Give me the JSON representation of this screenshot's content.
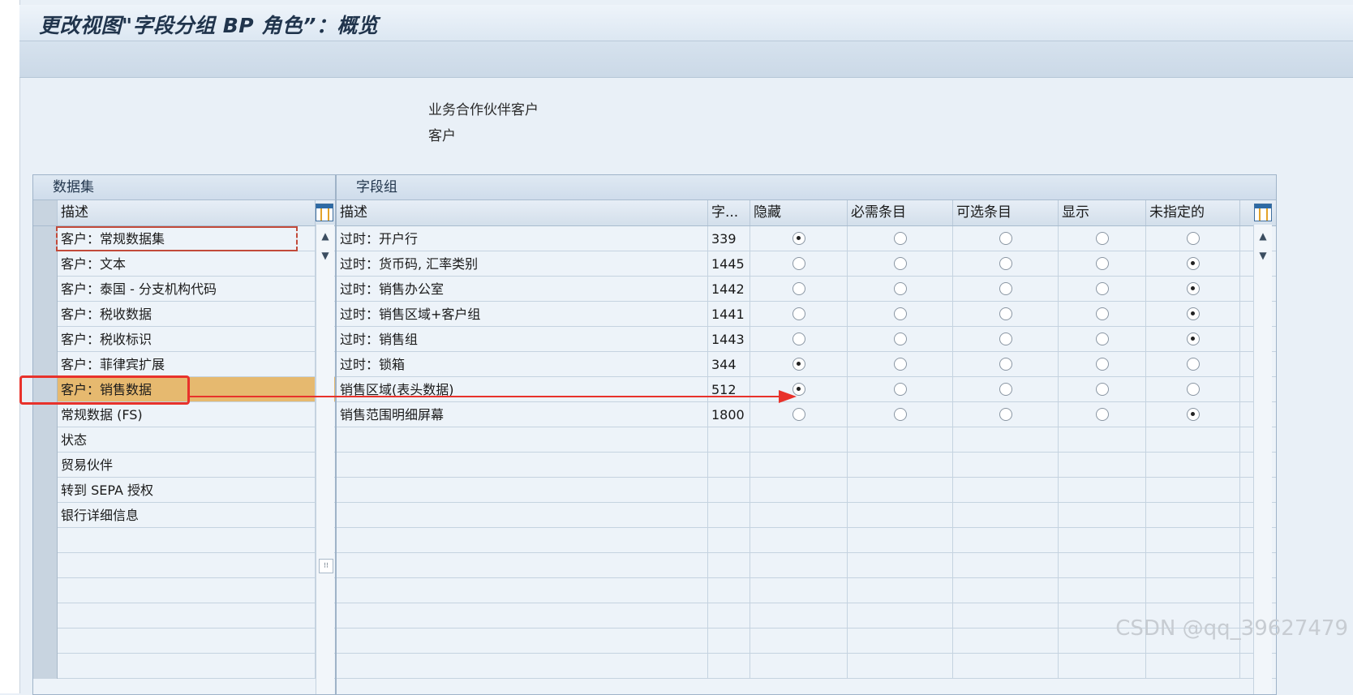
{
  "window": {
    "title": "更改视图\"字段分组 BP 角色”：概览"
  },
  "info": {
    "line1": "业务合作伙伴客户",
    "line2": "客户"
  },
  "left_panel": {
    "title": "数据集",
    "column_header": "描述",
    "rows": [
      "客户：常规数据集",
      "客户：文本",
      "客户：泰国 - 分支机构代码",
      "客户：税收数据",
      "客户：税收标识",
      "客户：菲律宾扩展",
      "客户：销售数据",
      "常规数据 (FS)",
      "状态",
      "贸易伙伴",
      "转到 SEPA 授权",
      "银行详细信息"
    ],
    "selected_index": 6
  },
  "right_panel": {
    "title": "字段组",
    "headers": [
      "描述",
      "字...",
      "隐藏",
      "必需条目",
      "可选条目",
      "显示",
      "未指定的"
    ],
    "rows": [
      {
        "desc": "过时：开户行",
        "num": "339",
        "choice": 0
      },
      {
        "desc": "过时：货币码, 汇率类别",
        "num": "1445",
        "choice": 4
      },
      {
        "desc": "过时：销售办公室",
        "num": "1442",
        "choice": 4
      },
      {
        "desc": "过时：销售区域+客户组",
        "num": "1441",
        "choice": 4
      },
      {
        "desc": "过时：销售组",
        "num": "1443",
        "choice": 4
      },
      {
        "desc": "过时：锁箱",
        "num": "344",
        "choice": 0
      },
      {
        "desc": "销售区域(表头数据)",
        "num": "512",
        "choice": 0
      },
      {
        "desc": "销售范围明细屏幕",
        "num": "1800",
        "choice": 4
      }
    ]
  },
  "watermark": "CSDN @qq_39627479",
  "colors": {
    "selected_row": "#e6b96f",
    "annotation": "#e8322b"
  }
}
